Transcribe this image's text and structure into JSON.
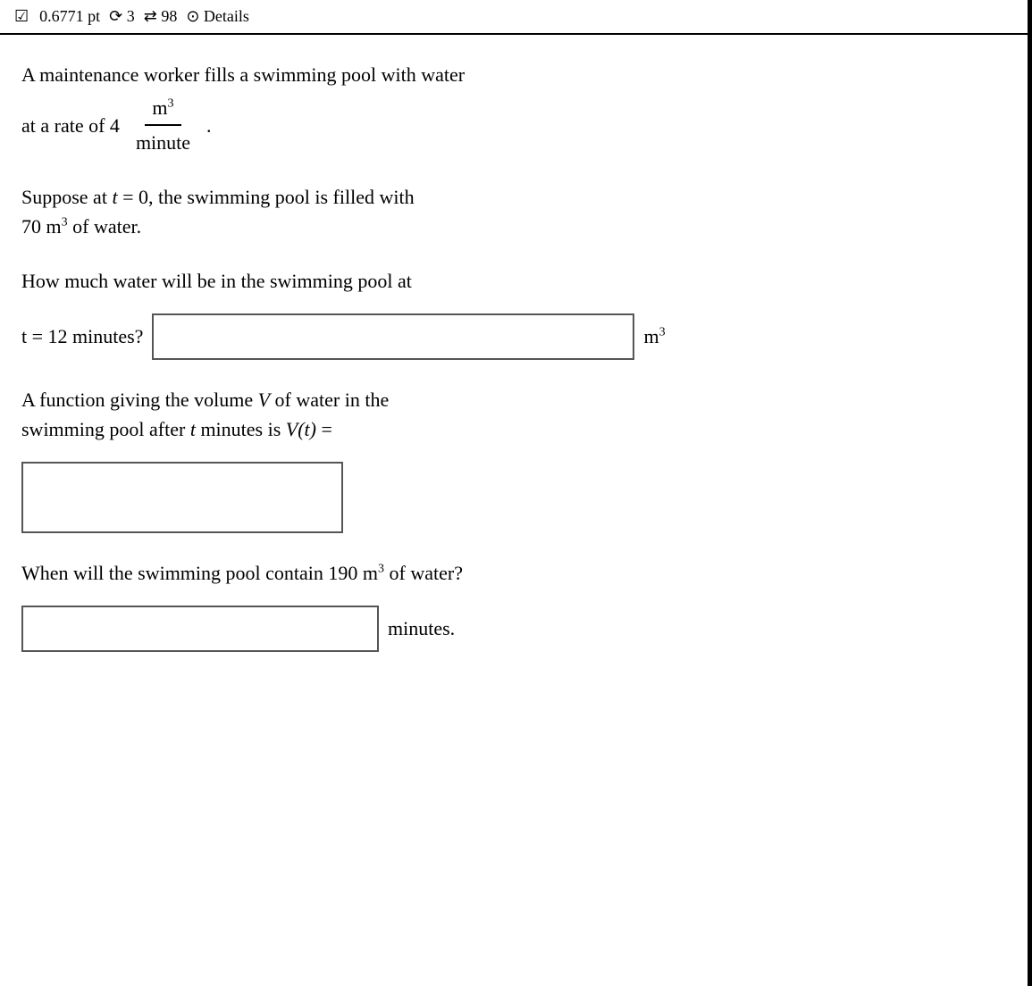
{
  "header": {
    "checkbox_symbol": "☑",
    "score": "0.6771 pt",
    "attempts_label": "⟳ 3",
    "refresh_label": "⇄ 98",
    "details_label": "⊙ Details"
  },
  "problem": {
    "intro": "A maintenance worker fills a swimming pool with water",
    "rate_prefix": "at a rate of 4",
    "rate_numerator": "m",
    "rate_numerator_exp": "3",
    "rate_denominator": "minute",
    "period": ".",
    "suppose_text": "Suppose at",
    "t_var": "t",
    "suppose_eq": "= 0, the swimming pool is filled with",
    "initial_volume": "70 m",
    "initial_volume_exp": "3",
    "initial_suffix": "of water.",
    "question1_line1": "How much water will be in the swimming pool at",
    "question1_line2_prefix": "t = 12 minutes?",
    "question1_unit": "m",
    "question1_unit_exp": "3",
    "question1_input_placeholder": "",
    "question2_line1": "A function giving the volume",
    "question2_V": "V",
    "question2_line1b": "of water in the",
    "question2_line2": "swimming pool after",
    "question2_t": "t",
    "question2_line2b": "minutes is",
    "question2_Vt": "V(t)",
    "question2_eq": "=",
    "question2_input_placeholder": "",
    "question3_line1": "When will the swimming pool contain 190 m",
    "question3_exp": "3",
    "question3_line1b": "of water?",
    "question3_unit": "minutes.",
    "question3_input_placeholder": ""
  }
}
